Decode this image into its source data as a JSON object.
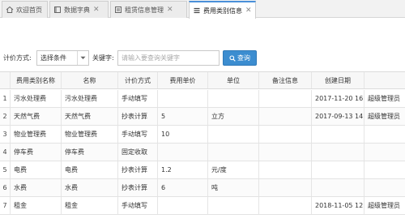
{
  "tabs": [
    {
      "label": "欢迎首页",
      "icon": "home-icon",
      "closable": false,
      "active": false
    },
    {
      "label": "数据字典",
      "icon": "book-icon",
      "closable": true,
      "active": false
    },
    {
      "label": "租赁信息管理",
      "icon": "form-icon",
      "closable": true,
      "active": false
    },
    {
      "label": "费用类别信息",
      "icon": "list-icon",
      "closable": true,
      "active": true
    }
  ],
  "search": {
    "method_label": "计价方式:",
    "method_value": "选择条件",
    "keyword_label": "关键字:",
    "keyword_placeholder": "请输入要查询关键字",
    "query_label": "查询"
  },
  "table": {
    "headers": [
      "",
      "费用类别名称",
      "名称",
      "计价方式",
      "费用单价",
      "单位",
      "备注信息",
      "创建日期",
      ""
    ],
    "rows": [
      [
        "1",
        "污水处理费",
        "污水处理费",
        "手动填写",
        "",
        "",
        "",
        "2017-11-20 16",
        "超级管理员"
      ],
      [
        "2",
        "天然气费",
        "天然气费",
        "抄表计算",
        "5",
        "立方",
        "",
        "2017-09-13 14",
        "超级管理员"
      ],
      [
        "3",
        "物业管理费",
        "物业管理费",
        "手动填写",
        "10",
        "",
        "",
        "",
        ""
      ],
      [
        "4",
        "停车费",
        "停车费",
        "固定收取",
        "",
        "",
        "",
        "",
        ""
      ],
      [
        "5",
        "电费",
        "电费",
        "抄表计算",
        "1.2",
        "元/度",
        "",
        "",
        ""
      ],
      [
        "6",
        "水费",
        "水费",
        "抄表计算",
        "6",
        "吨",
        "",
        "",
        ""
      ],
      [
        "7",
        "租金",
        "租金",
        "手动填写",
        "",
        "",
        "",
        "2018-11-05 12",
        "超级管理员"
      ]
    ]
  },
  "colors": {
    "accent": "#3c8dd0",
    "tab_active_border": "#4a90d9"
  }
}
